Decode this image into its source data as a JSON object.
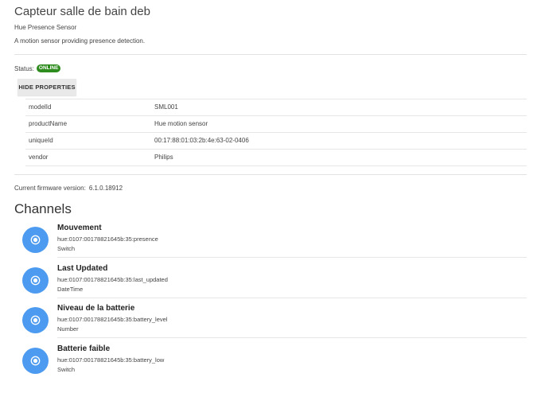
{
  "thing": {
    "title": "Capteur salle de bain deb",
    "type_label": "Hue Presence Sensor",
    "description": "A motion sensor providing presence detection."
  },
  "status": {
    "label": "Status:",
    "value": "ONLINE",
    "color": "#2e8b1e"
  },
  "properties": {
    "toggle_label": "HIDE PROPERTIES",
    "rows": [
      {
        "key": "modelId",
        "value": "SML001"
      },
      {
        "key": "productName",
        "value": "Hue motion sensor"
      },
      {
        "key": "uniqueId",
        "value": "00:17:88:01:03:2b:4e:63-02-0406"
      },
      {
        "key": "vendor",
        "value": "Philips"
      }
    ]
  },
  "firmware": {
    "label": "Current firmware version:",
    "value": "6.1.0.18912"
  },
  "channels": {
    "heading": "Channels",
    "icon": "radio-button-icon",
    "icon_color": "#4d9bf0",
    "items": [
      {
        "name": "Mouvement",
        "uid": "hue:0107:00178821645b:35:presence",
        "type": "Switch"
      },
      {
        "name": "Last Updated",
        "uid": "hue:0107:00178821645b:35:last_updated",
        "type": "DateTime"
      },
      {
        "name": "Niveau de la batterie",
        "uid": "hue:0107:00178821645b:35:battery_level",
        "type": "Number"
      },
      {
        "name": "Batterie faible",
        "uid": "hue:0107:00178821645b:35:battery_low",
        "type": "Switch"
      }
    ]
  }
}
